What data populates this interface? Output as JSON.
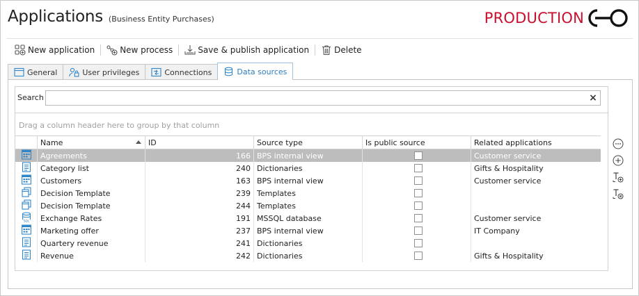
{
  "header": {
    "title": "Applications",
    "subtitle": "(Business Entity Purchases)",
    "environment": "PRODUCTION",
    "environment_color": "#c8102e"
  },
  "toolbar": {
    "new_application": "New application",
    "new_process": "New process",
    "save_publish": "Save & publish application",
    "delete": "Delete"
  },
  "tabs": [
    {
      "label": "General",
      "icon": "window-icon"
    },
    {
      "label": "User privileges",
      "icon": "user-lock-icon"
    },
    {
      "label": "Connections",
      "icon": "connections-icon"
    },
    {
      "label": "Data sources",
      "icon": "database-icon"
    }
  ],
  "active_tab": "Data sources",
  "search": {
    "label": "Search",
    "value": ""
  },
  "grid": {
    "group_hint": "Drag a column header here to group by that column",
    "columns": [
      "Name",
      "ID",
      "Source type",
      "Is public source",
      "Related applications"
    ],
    "sorted_column": "Name",
    "rows": [
      {
        "icon": "bps-view-icon",
        "name": "Agreements",
        "id": "166",
        "source_type": "BPS internal view",
        "is_public": false,
        "related": "Customer service",
        "selected": true
      },
      {
        "icon": "dictionary-icon",
        "name": "Category list",
        "id": "240",
        "source_type": "Dictionaries",
        "is_public": false,
        "related": "Gifts & Hospitality"
      },
      {
        "icon": "bps-view-icon",
        "name": "Customers",
        "id": "163",
        "source_type": "BPS internal view",
        "is_public": false,
        "related": "Customer service"
      },
      {
        "icon": "template-icon",
        "name": "Decision Template",
        "id": "239",
        "source_type": "Templates",
        "is_public": false,
        "related": ""
      },
      {
        "icon": "template-icon",
        "name": "Decision Template",
        "id": "244",
        "source_type": "Templates",
        "is_public": false,
        "related": ""
      },
      {
        "icon": "mssql-icon",
        "name": "Exchange Rates",
        "id": "191",
        "source_type": "MSSQL database",
        "is_public": false,
        "related": "Customer service"
      },
      {
        "icon": "bps-view-icon",
        "name": "Marketing offer",
        "id": "237",
        "source_type": "BPS internal view",
        "is_public": false,
        "related": "IT Company"
      },
      {
        "icon": "dictionary-icon",
        "name": "Quartery revenue",
        "id": "241",
        "source_type": "Dictionaries",
        "is_public": false,
        "related": ""
      },
      {
        "icon": "dictionary-icon",
        "name": "Revenue",
        "id": "242",
        "source_type": "Dictionaries",
        "is_public": false,
        "related": "Gifts & Hospitality"
      }
    ]
  },
  "side_actions": [
    "more-options-icon",
    "add-icon",
    "add-column-icon",
    "remove-column-icon"
  ],
  "colors": {
    "accent": "#2b7cc0",
    "selected_row": "#bdbdbd",
    "icon_blue": "#2f86c9"
  }
}
